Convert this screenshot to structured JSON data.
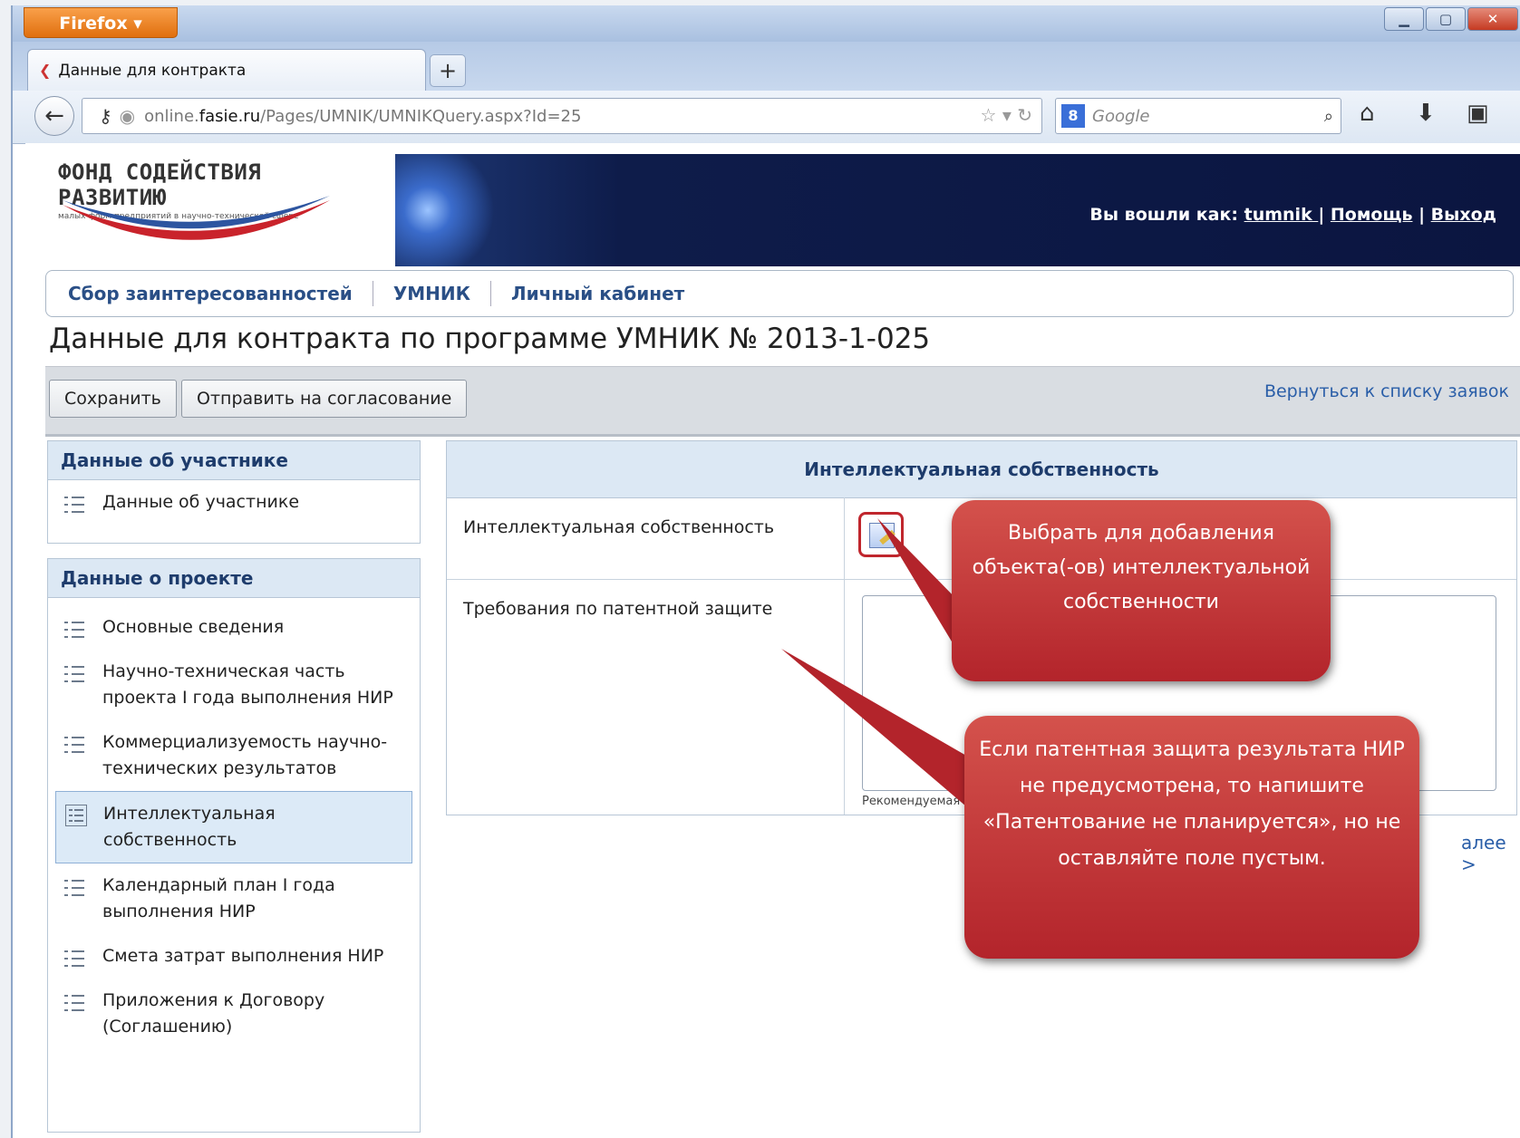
{
  "browser": {
    "menu_label": "Firefox ▾",
    "tab_title": "Данные для контракта",
    "url_prefix": "online.",
    "url_host": "fasie.ru",
    "url_path": "/Pages/UMNIK/UMNIKQuery.aspx?Id=25",
    "search_placeholder": "Google"
  },
  "site": {
    "logo_line1": "ФОНД СОДЕЙСТВИЯ РАЗВИТИЮ",
    "logo_line2": "малых форм предприятий в научно-технической сфере",
    "logged_in_label": "Вы вошли как:",
    "username": "tumnik ",
    "help_link": "Помощь",
    "logout_link": "Выход",
    "sep": "|"
  },
  "menu": {
    "items": [
      "Сбор заинтересованностей",
      "УМНИК",
      "Личный кабинет"
    ]
  },
  "page": {
    "title": "Данные для контракта по программе УМНИК № 2013-1-025",
    "save_label": "Сохранить",
    "send_label": "Отправить на согласование",
    "back_link": "Вернуться к списку заявок",
    "next_link": "алее >"
  },
  "sidebar": {
    "participant_header": "Данные об участнике",
    "participant_items": [
      "Данные об участнике"
    ],
    "project_header": "Данные о проекте",
    "project_items": [
      "Основные сведения",
      "Научно-техническая часть проекта I года выполнения НИР",
      "Коммерциализуемость научно-технических результатов",
      "Интеллектуальная собственность",
      "Календарный план I года выполнения НИР",
      "Смета затрат выполнения НИР",
      "Приложения к Договору (Соглашению)"
    ]
  },
  "form": {
    "header": "Интеллектуальная собственность",
    "ip_label": "Интеллектуальная собственность",
    "patent_label": "Требования по патентной защите",
    "hint": "Рекомендуемая"
  },
  "callouts": {
    "top": "Выбрать для добавления объекта(-ов) интеллектуальной собственности",
    "bottom": "Если патентная защита результата НИР не предусмотрена, то напишите «Патентование не планируется», но не оставляйте поле пустым."
  },
  "colors": {
    "callout": "#b3242b",
    "link": "#2a5ea8",
    "header_bg": "#dce8f4"
  }
}
